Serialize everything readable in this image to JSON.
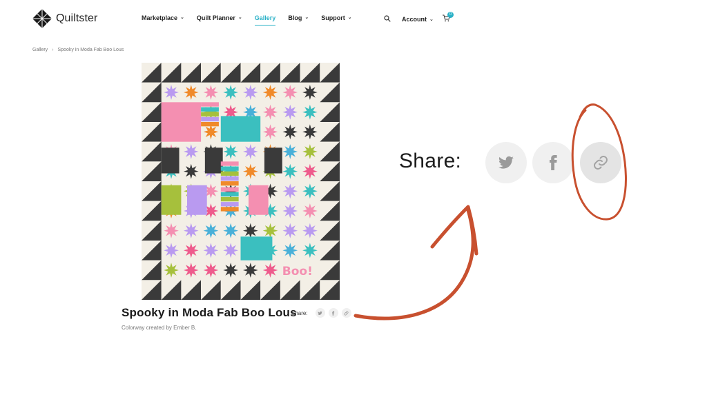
{
  "header": {
    "logo_text": "Quiltster",
    "nav": [
      {
        "label": "Marketplace",
        "dropdown": true,
        "active": false
      },
      {
        "label": "Quilt Planner",
        "dropdown": true,
        "active": false
      },
      {
        "label": "Gallery",
        "dropdown": false,
        "active": true
      },
      {
        "label": "Blog",
        "dropdown": true,
        "active": false
      },
      {
        "label": "Support",
        "dropdown": true,
        "active": false
      }
    ],
    "account_label": "Account",
    "cart_count": "0",
    "icons": {
      "search": "search-icon",
      "cart": "cart-icon",
      "chevron": "chevron-down-icon"
    }
  },
  "breadcrumb": {
    "root": "Gallery",
    "current": "Spooky in Moda Fab Boo Lous"
  },
  "quilt": {
    "colors": {
      "cream": "#f3efe6",
      "charcoal": "#3a3a3a",
      "pink": "#f48fb1",
      "teal": "#3bbfbf",
      "lime": "#a6c03c",
      "purple": "#b99af0",
      "orange": "#f08a2a",
      "blue": "#49b0d8",
      "hotpink": "#ee5b8c"
    }
  },
  "project": {
    "title": "Spooky in Moda Fab Boo Lous",
    "subtitle": "Colorway created by Ember B.",
    "share_label": "Share:"
  },
  "share_zoom": {
    "label": "Share:",
    "buttons": [
      "twitter-icon",
      "facebook-icon",
      "link-icon"
    ]
  },
  "annotation": {
    "color": "#c8502f"
  }
}
